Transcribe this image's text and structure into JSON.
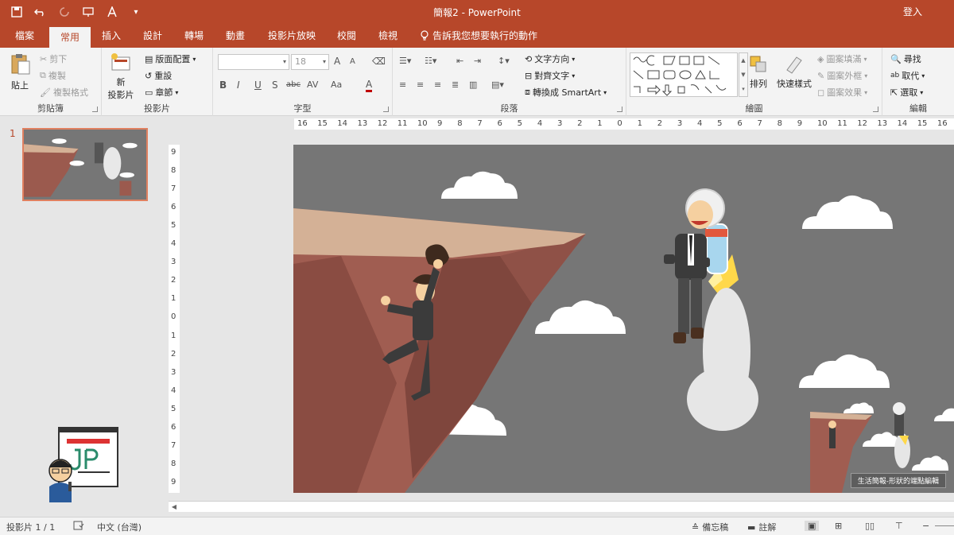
{
  "window": {
    "title": "簡報2 - PowerPoint",
    "signin": "登入",
    "accent": "#b7472a"
  },
  "tabs": [
    {
      "label": "檔案"
    },
    {
      "label": "常用",
      "active": true
    },
    {
      "label": "插入"
    },
    {
      "label": "設計"
    },
    {
      "label": "轉場"
    },
    {
      "label": "動畫"
    },
    {
      "label": "投影片放映"
    },
    {
      "label": "校閱"
    },
    {
      "label": "檢視"
    }
  ],
  "tellme": "告訴我您想要執行的動作",
  "ribbon": {
    "clipboard": {
      "label": "剪貼簿",
      "paste": "貼上",
      "cut": "剪下",
      "copy": "複製",
      "format_painter": "複製格式"
    },
    "slides": {
      "label": "投影片",
      "new_slide_1": "新",
      "new_slide_2": "投影片",
      "layout": "版面配置",
      "reset": "重設",
      "section": "章節"
    },
    "font": {
      "label": "字型",
      "font_name": "",
      "font_size": "18",
      "bold": "B",
      "italic": "I",
      "underline": "U",
      "shadow": "S",
      "strike": "abc",
      "spacing": "AV",
      "case": "Aa",
      "color": "A",
      "grow": "A",
      "shrink": "A"
    },
    "paragraph": {
      "label": "段落",
      "text_direction": "文字方向",
      "align_text": "對齊文字",
      "smartart": "轉換成 SmartArt"
    },
    "drawing": {
      "label": "繪圖",
      "arrange": "排列",
      "quick_styles": "快速樣式",
      "shape_fill": "圖案填滿",
      "shape_outline": "圖案外框",
      "shape_effects": "圖案效果"
    },
    "editing": {
      "label": "編輯",
      "find": "尋找",
      "replace": "取代",
      "select": "選取"
    }
  },
  "thumbnails": [
    {
      "number": "1"
    }
  ],
  "ruler": {
    "h_ticks": [
      "16",
      "15",
      "14",
      "13",
      "12",
      "11",
      "10",
      "9",
      "8",
      "7",
      "6",
      "5",
      "4",
      "3",
      "2",
      "1",
      "0",
      "1",
      "2",
      "3",
      "4",
      "5",
      "6",
      "7",
      "8",
      "9",
      "10",
      "11",
      "12",
      "13",
      "14",
      "15",
      "16"
    ],
    "v_ticks": [
      "9",
      "8",
      "7",
      "6",
      "5",
      "4",
      "3",
      "2",
      "1",
      "0",
      "1",
      "2",
      "3",
      "4",
      "5",
      "6",
      "7",
      "8",
      "9"
    ]
  },
  "slide": {
    "caption": "生活簡報-形狀的端點編輯",
    "background": "#767676"
  },
  "status": {
    "slide_info": "投影片 1 / 1",
    "language": "中文 (台灣)",
    "notes": "備忘稿",
    "comments": "註解"
  }
}
